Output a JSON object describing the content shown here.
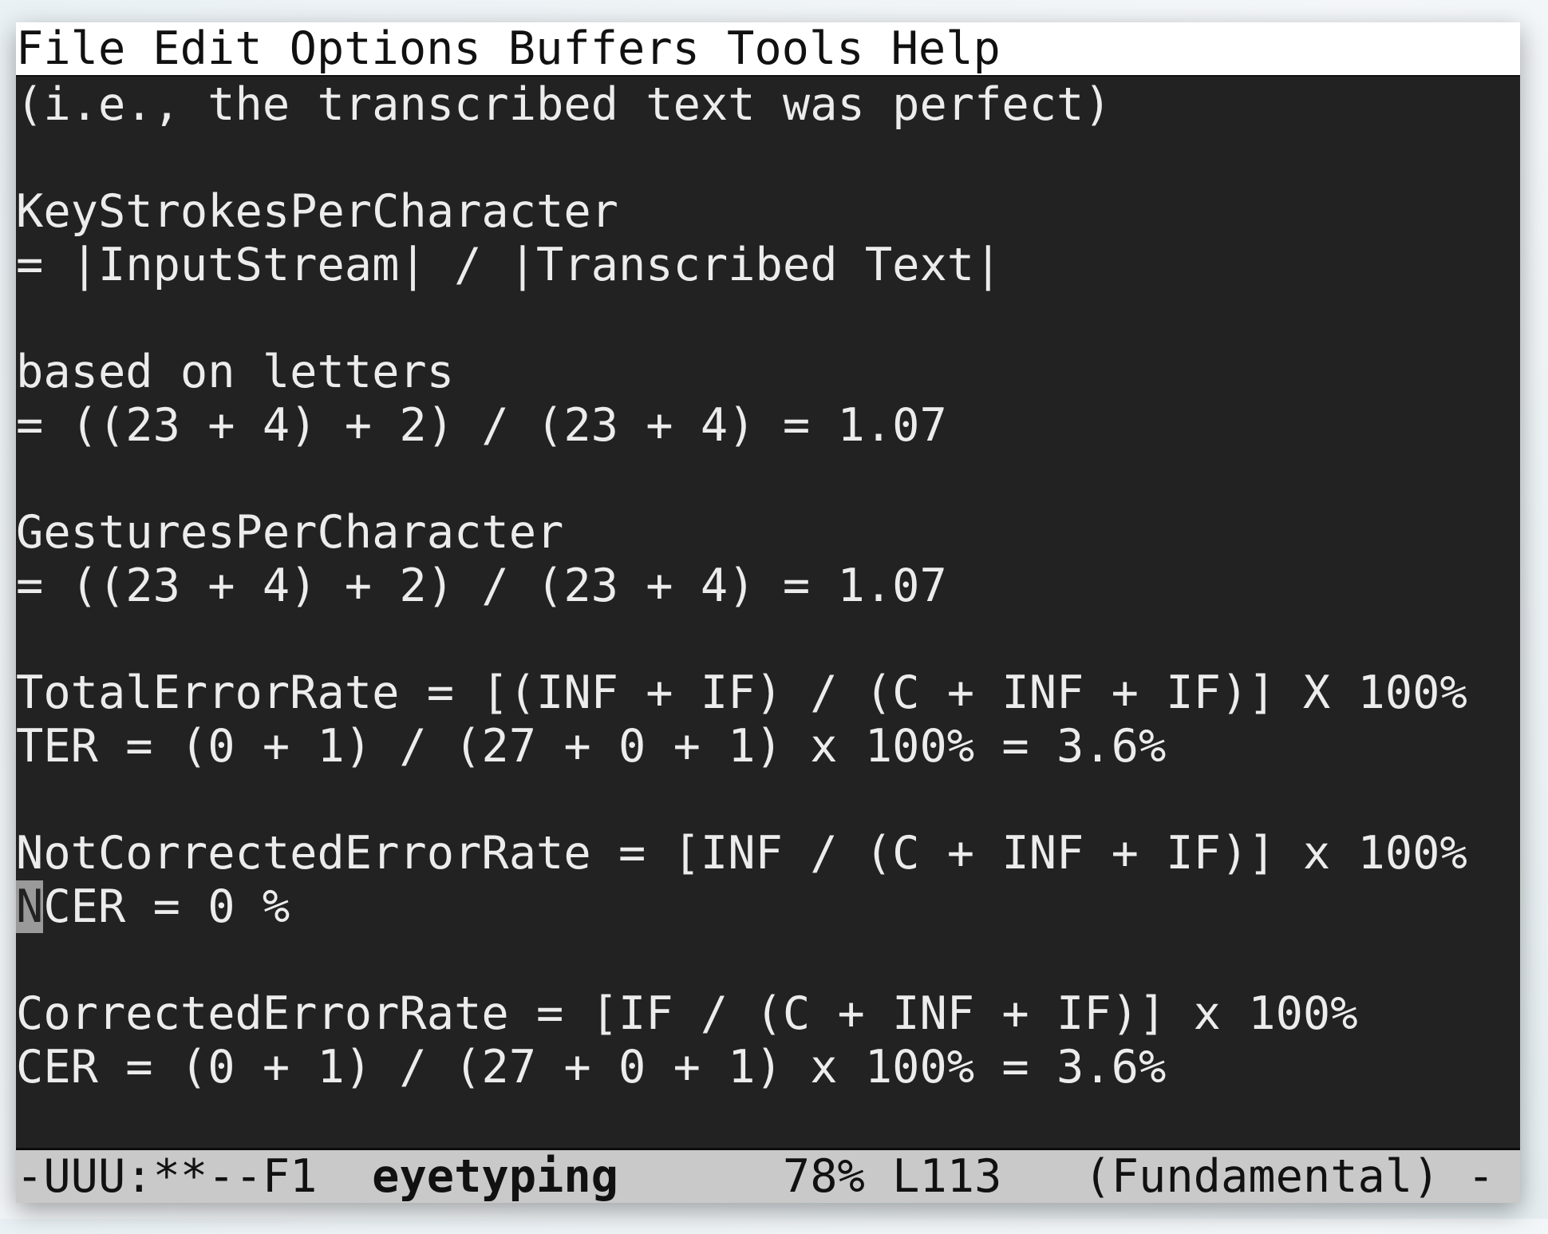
{
  "menu": [
    "File",
    "Edit",
    "Options",
    "Buffers",
    "Tools",
    "Help"
  ],
  "buffer_lines": [
    "(i.e., the transcribed text was perfect)",
    "",
    "KeyStrokesPerCharacter",
    "= |InputStream| / |Transcribed Text|",
    "",
    "based on letters",
    "= ((23 + 4) + 2) / (23 + 4) = 1.07",
    "",
    "GesturesPerCharacter",
    "= ((23 + 4) + 2) / (23 + 4) = 1.07",
    "",
    "TotalErrorRate = [(INF + IF) / (C + INF + IF)] X 100%",
    "TER = (0 + 1) / (27 + 0 + 1) x 100% = 3.6%",
    "",
    "NotCorrectedErrorRate = [INF / (C + INF + IF)] x 100%",
    "",
    "",
    "CorrectedErrorRate = [IF / (C + INF + IF)] x 100%",
    "CER = (0 + 1) / (27 + 0 + 1) x 100% = 3.6%"
  ],
  "cursor_line": {
    "cursor_char": "N",
    "rest": "CER = 0 %"
  },
  "modeline": {
    "status": "-UUU:**--F1  ",
    "buffer_name": "eyetyping",
    "position": "      78% L113   ",
    "mode": "(Fundamental) -"
  }
}
